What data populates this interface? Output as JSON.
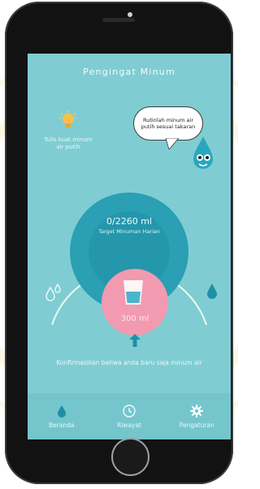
{
  "header": {
    "title": "Pengingat Minum"
  },
  "tip": {
    "text": "Tulis kuat minum air putih"
  },
  "bubble": {
    "text": "Rutinlah minum air putih sesuai takaran"
  },
  "progress": {
    "amount": "0/2260 ml",
    "label": "Target Minuman Harian",
    "fraction": 0
  },
  "drink_button": {
    "amount": "300 ml"
  },
  "confirm_text": "Konfirmasikan bahwa anda baru saja minum air",
  "nav": {
    "items": [
      {
        "label": "Beranda",
        "icon": "drop-icon"
      },
      {
        "label": "Riwayat",
        "icon": "clock-icon"
      },
      {
        "label": "Pengaturan",
        "icon": "gear-icon"
      }
    ]
  },
  "colors": {
    "screen_bg": "#7fcdd3",
    "circle_dark": "#2b9fb3",
    "circle_deep": "#1f8fa8",
    "glass_button": "#f29ab0",
    "accent_drop": "#1f8fa8"
  }
}
